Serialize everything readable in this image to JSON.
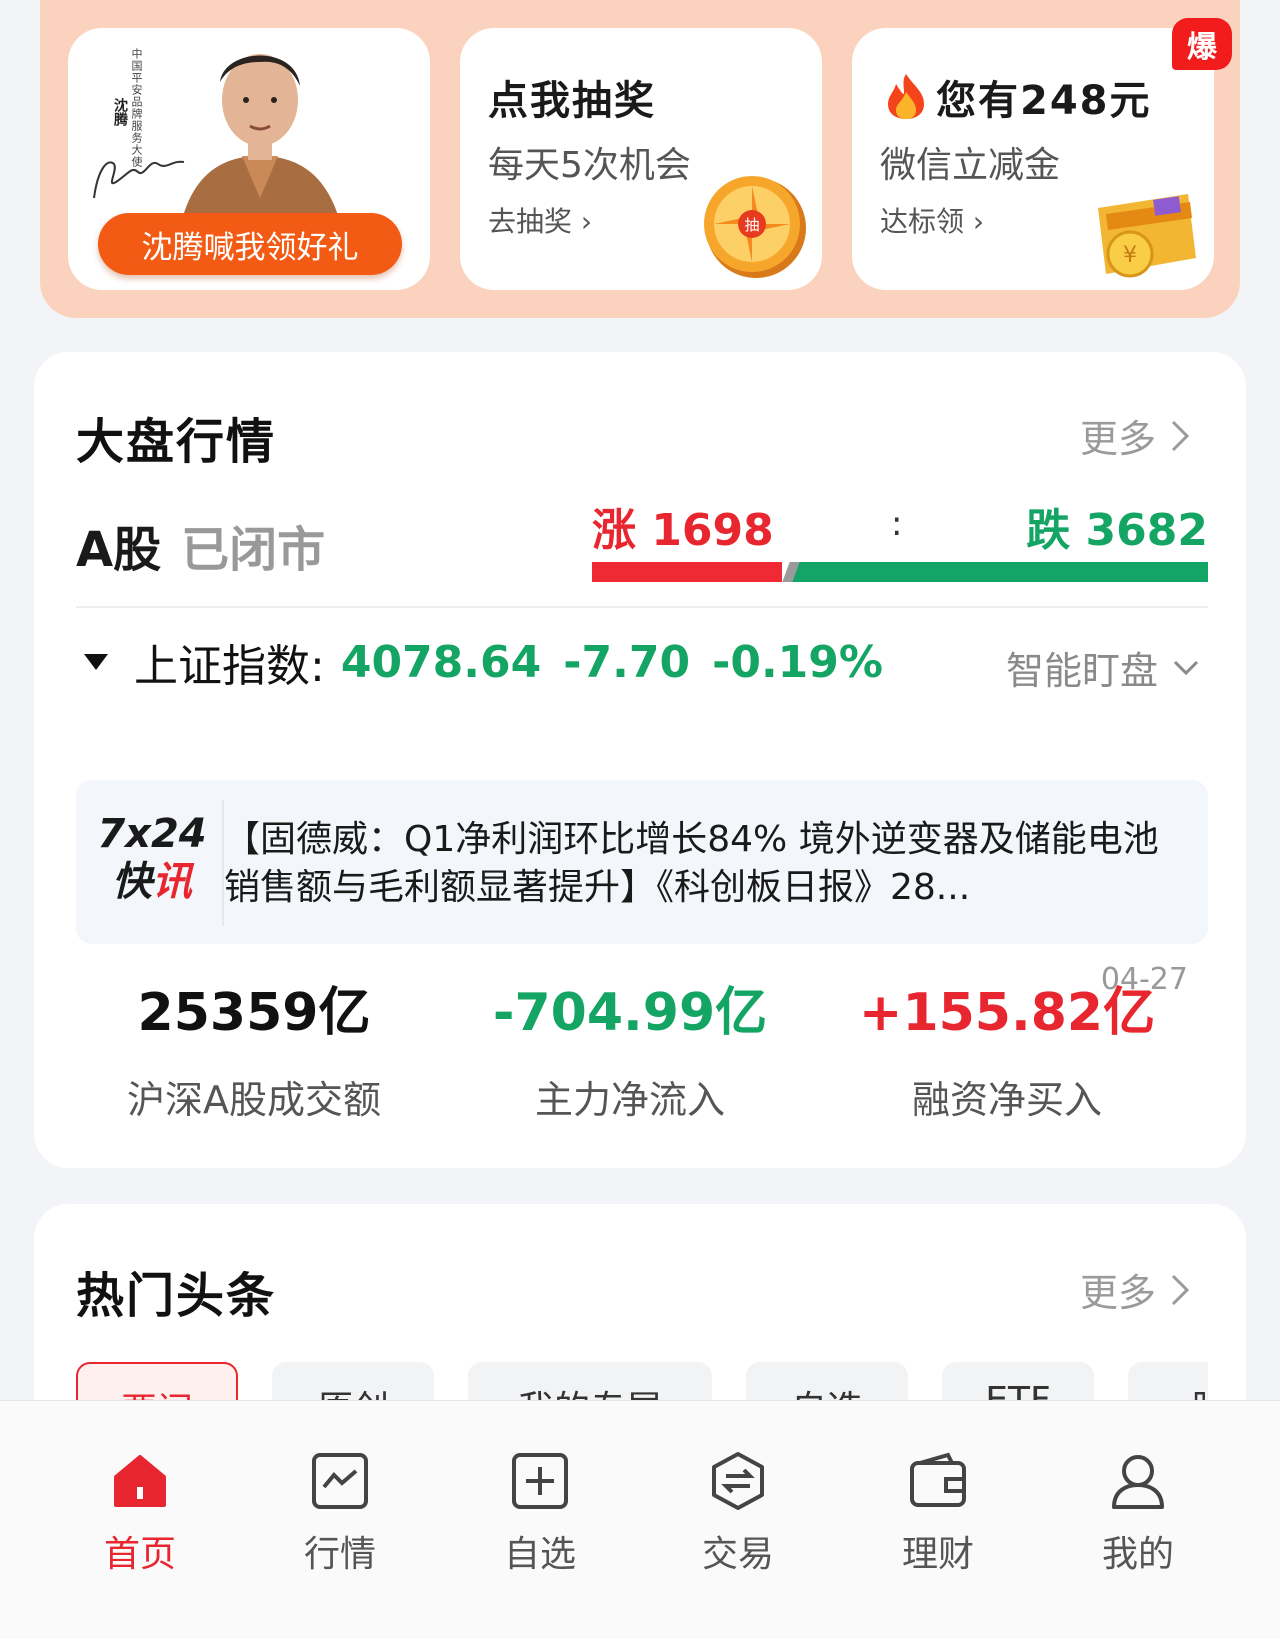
{
  "promo": {
    "card1": {
      "vertical_text": "中国平安品牌服务大使",
      "name_vertical": "沈腾",
      "button": "沈腾喊我领好礼"
    },
    "card2": {
      "title": "点我抽奖",
      "subtitle": "每天5次机会",
      "link": "去抽奖",
      "coin_char": "抽"
    },
    "card3": {
      "title": "您有248元",
      "subtitle": "微信立减金",
      "link": "达标领",
      "badge": "爆"
    }
  },
  "market": {
    "title": "大盘行情",
    "more": "更多",
    "a_label": "A股",
    "status": "已闭市",
    "rise_label": "涨 1698",
    "colon": ":",
    "fall_label": "跌 3682",
    "rise_count": 1698,
    "fall_count": 3682,
    "index": {
      "name": "上证指数:",
      "value": "4078.64",
      "change": "-7.70",
      "pct": "-0.19%"
    },
    "smart": "智能盯盘",
    "news": {
      "logo_line1": "7x24",
      "logo_line2a": "快",
      "logo_line2b": "讯",
      "text": "【固德威：Q1净利润环比增长84% 境外逆变器及储能电池销售额与毛利额显著提升】《科创板日报》28..."
    },
    "stats": [
      {
        "value": "25359亿",
        "label": "沪深A股成交额"
      },
      {
        "value": "-704.99亿",
        "label": "主力净流入"
      },
      {
        "value": "+155.82亿",
        "label": "融资净买入"
      }
    ],
    "stats_date": "04-27"
  },
  "hot": {
    "title": "热门头条",
    "more": "更多",
    "tabs": [
      "要闻",
      "原创",
      "我的专属",
      "自选",
      "ETF",
      "股"
    ]
  },
  "nav": {
    "items": [
      "首页",
      "行情",
      "自选",
      "交易",
      "理财",
      "我的"
    ],
    "accent": "#e8262f"
  },
  "colors": {
    "up": "#e8262f",
    "down": "#14a565",
    "banner": "#fbd2bd",
    "button": "#f35a14"
  }
}
